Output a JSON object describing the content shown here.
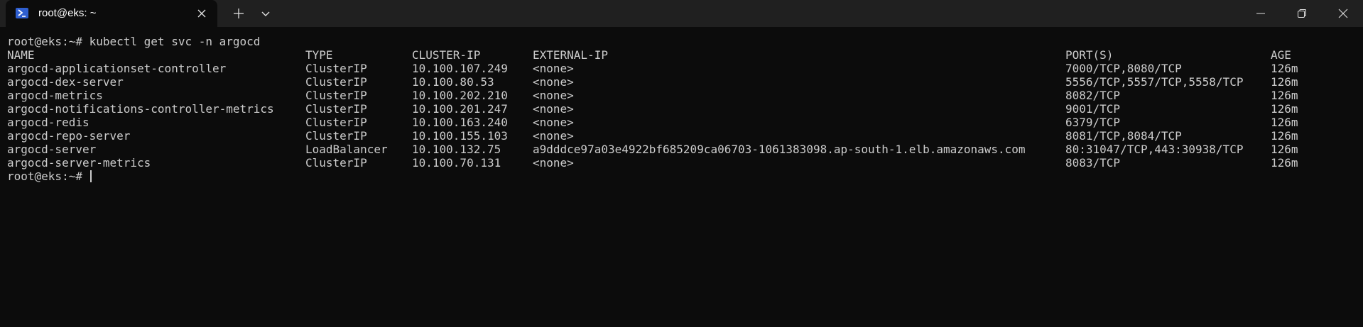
{
  "tab": {
    "title": "root@eks: ~",
    "icon": "powershell-icon"
  },
  "colors": {
    "terminal_bg": "#0c0c0c",
    "titlebar_bg": "#202020",
    "text": "#cccccc",
    "tab_icon": "#2f5fd0"
  },
  "terminal": {
    "command_line": "root@eks:~# kubectl get svc -n argocd",
    "headers": [
      "NAME",
      "TYPE",
      "CLUSTER-IP",
      "EXTERNAL-IP",
      "PORT(S)",
      "AGE"
    ],
    "rows": [
      [
        "argocd-applicationset-controller",
        "ClusterIP",
        "10.100.107.249",
        "<none>",
        "7000/TCP,8080/TCP",
        "126m"
      ],
      [
        "argocd-dex-server",
        "ClusterIP",
        "10.100.80.53",
        "<none>",
        "5556/TCP,5557/TCP,5558/TCP",
        "126m"
      ],
      [
        "argocd-metrics",
        "ClusterIP",
        "10.100.202.210",
        "<none>",
        "8082/TCP",
        "126m"
      ],
      [
        "argocd-notifications-controller-metrics",
        "ClusterIP",
        "10.100.201.247",
        "<none>",
        "9001/TCP",
        "126m"
      ],
      [
        "argocd-redis",
        "ClusterIP",
        "10.100.163.240",
        "<none>",
        "6379/TCP",
        "126m"
      ],
      [
        "argocd-repo-server",
        "ClusterIP",
        "10.100.155.103",
        "<none>",
        "8081/TCP,8084/TCP",
        "126m"
      ],
      [
        "argocd-server",
        "LoadBalancer",
        "10.100.132.75",
        "a9dddce97a03e4922bf685209ca06703-1061383098.ap-south-1.elb.amazonaws.com",
        "80:31047/TCP,443:30938/TCP",
        "126m"
      ],
      [
        "argocd-server-metrics",
        "ClusterIP",
        "10.100.70.131",
        "<none>",
        "8083/TCP",
        "126m"
      ]
    ],
    "prompt": "root@eks:~# "
  }
}
